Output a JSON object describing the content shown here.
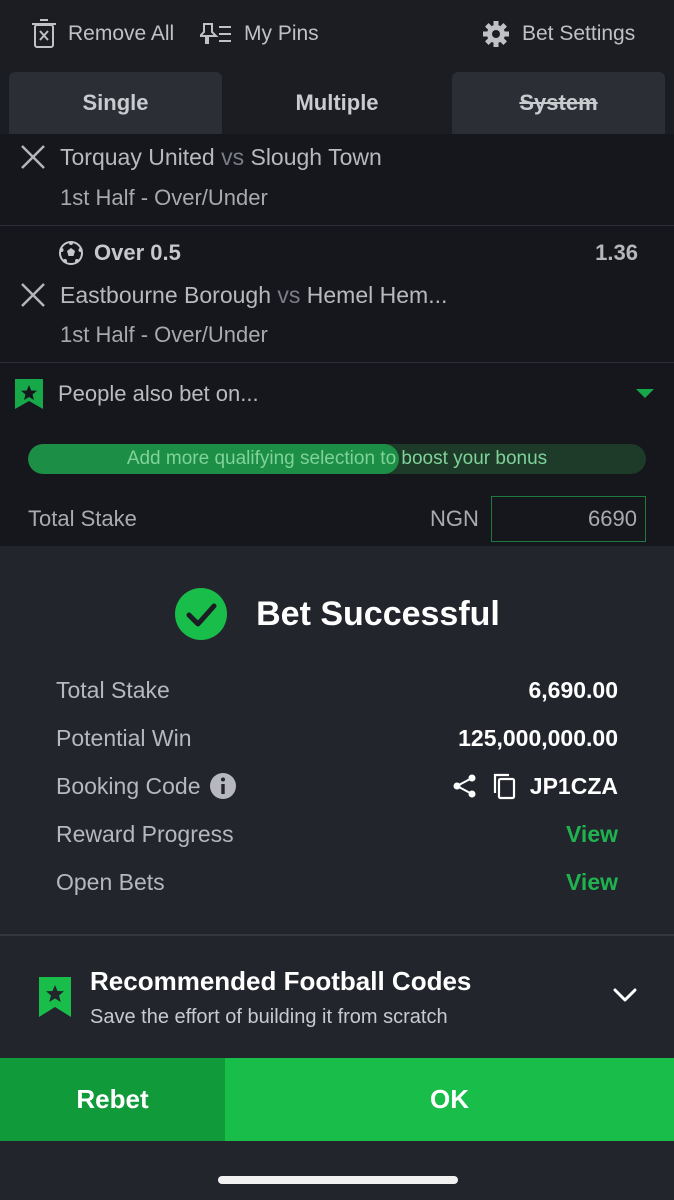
{
  "topbar": {
    "remove_all": "Remove All",
    "my_pins": "My Pins",
    "bet_settings": "Bet Settings"
  },
  "tabs": [
    {
      "label": "Single"
    },
    {
      "label": "Multiple"
    },
    {
      "label": "System"
    }
  ],
  "selections": [
    {
      "home": "Torquay United",
      "vs": "vs",
      "away": "Slough Town",
      "market": "1st Half - Over/Under"
    },
    {
      "pick": "Over 0.5",
      "odds": "1.36",
      "home": "Eastbourne Borough",
      "vs": "vs",
      "away": "Hemel Hem...",
      "market": "1st Half - Over/Under"
    }
  ],
  "people_also_bet": "People also bet on...",
  "bonus": {
    "label": "Add more qualifying selection to boost your bonus",
    "progress": 0.6
  },
  "stake": {
    "label": "Total Stake",
    "currency": "NGN",
    "value": "6690"
  },
  "result": {
    "title": "Bet Successful",
    "rows": [
      {
        "label": "Total Stake",
        "value": "6,690.00"
      },
      {
        "label": "Potential Win",
        "value": "125,000,000.00"
      },
      {
        "label": "Booking Code",
        "value": "JP1CZA"
      },
      {
        "label": "Reward Progress",
        "value": "View"
      },
      {
        "label": "Open Bets",
        "value": "View"
      }
    ]
  },
  "recommended": {
    "title": "Recommended Football Codes",
    "subtitle": "Save the effort of building it from scratch"
  },
  "buttons": {
    "rebet": "Rebet",
    "ok": "OK"
  },
  "colors": {
    "accent": "#19bd4a",
    "accent_dark": "#119a3a",
    "panel": "#22252b"
  }
}
